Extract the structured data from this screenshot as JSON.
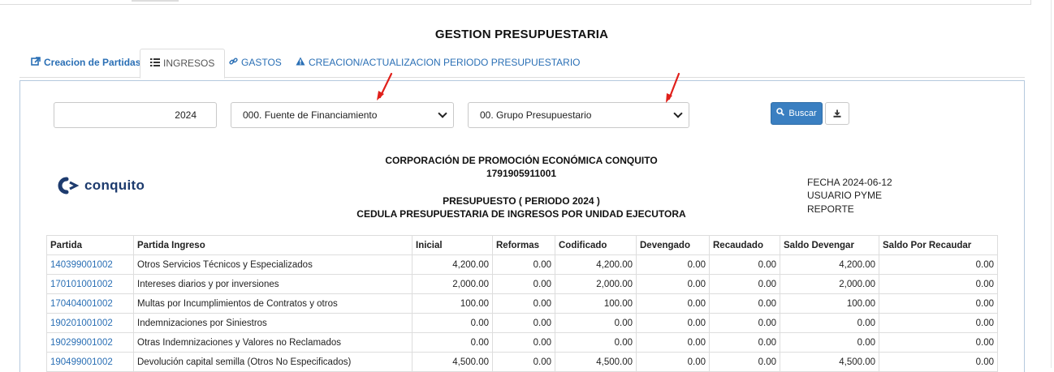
{
  "page": {
    "title": "GESTION PRESUPUESTARIA"
  },
  "tabs": [
    {
      "label": "Creacion de Partidas",
      "icon": "external-link-icon",
      "active": false
    },
    {
      "label": "INGRESOS",
      "icon": "list-icon",
      "active": true
    },
    {
      "label": "GASTOS",
      "icon": "link-icon",
      "active": false
    },
    {
      "label": "CREACION/ACTUALIZACION PERIODO PRESUPUESTARIO",
      "icon": "warning-icon",
      "active": false
    }
  ],
  "filters": {
    "year_value": "2024",
    "fuente_selected": "000. Fuente de Financiamiento",
    "grupo_selected": "00. Grupo Presupuestario",
    "search_label": "Buscar",
    "search_icon": "search-icon",
    "download_icon": "download-icon"
  },
  "report": {
    "company": "CORPORACIÓN DE PROMOCIÓN ECONÓMICA CONQUITO",
    "ruc": "1791905911001",
    "period_title": "PRESUPUESTO ( PERIODO 2024 )",
    "subtitle": "CEDULA PRESUPUESTARIA DE INGRESOS POR UNIDAD EJECUTORA",
    "logo_text": "conquito",
    "fecha": "FECHA 2024-06-12",
    "usuario": "USUARIO PYME",
    "reporte": "REPORTE"
  },
  "table": {
    "columns": [
      "Partida",
      "Partida Ingreso",
      "Inicial",
      "Reformas",
      "Codificado",
      "Devengado",
      "Recaudado",
      "Saldo Devengar",
      "Saldo Por Recaudar"
    ],
    "rows": [
      [
        "140399001002",
        "Otros Servicios Técnicos y Especializados",
        "4,200.00",
        "0.00",
        "4,200.00",
        "0.00",
        "0.00",
        "4,200.00",
        "0.00"
      ],
      [
        "170101001002",
        "Intereses diarios y por inversiones",
        "2,000.00",
        "0.00",
        "2,000.00",
        "0.00",
        "0.00",
        "2,000.00",
        "0.00"
      ],
      [
        "170404001002",
        "Multas por Incumplimientos de Contratos y otros",
        "100.00",
        "0.00",
        "100.00",
        "0.00",
        "0.00",
        "100.00",
        "0.00"
      ],
      [
        "190201001002",
        "Indemnizaciones por Siniestros",
        "0.00",
        "0.00",
        "0.00",
        "0.00",
        "0.00",
        "0.00",
        "0.00"
      ],
      [
        "190299001002",
        "Otras Indemnizaciones y Valores no Reclamados",
        "0.00",
        "0.00",
        "0.00",
        "0.00",
        "0.00",
        "0.00",
        "0.00"
      ],
      [
        "190499001002",
        "Devolución capital semilla (Otros No Especificados)",
        "4,500.00",
        "0.00",
        "4,500.00",
        "0.00",
        "0.00",
        "4,500.00",
        "0.00"
      ]
    ]
  },
  "colors": {
    "accent": "#2a6fb5",
    "button": "#3a7fc1",
    "annotation_arrow": "#e0201b",
    "logo_dark": "#1d3b6e"
  }
}
